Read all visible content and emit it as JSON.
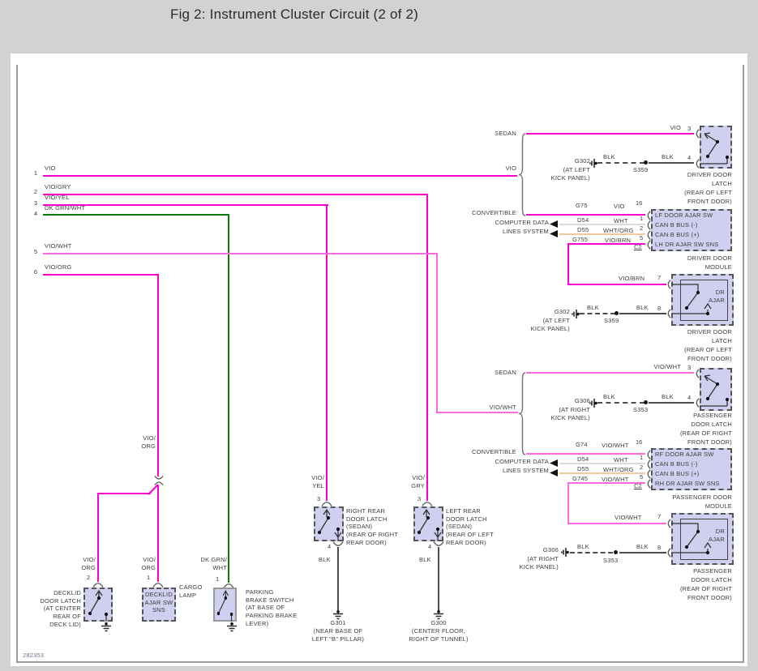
{
  "header": {
    "title": "Fig 2: Instrument Cluster Circuit (2 of 2)"
  },
  "footer": {
    "code": "282353"
  },
  "bus": {
    "wires": [
      {
        "num": "1",
        "label": "VIO"
      },
      {
        "num": "2",
        "label": "VIO/GRY"
      },
      {
        "num": "3",
        "label": "VIO/YEL"
      },
      {
        "num": "4",
        "label": "DK GRN/WHT"
      },
      {
        "num": "5",
        "label": "VIO/WHT"
      },
      {
        "num": "6",
        "label": "VIO/ORG"
      }
    ],
    "mid_label": "VIO/\nORG"
  },
  "bottom": {
    "decklid_latch": {
      "wire": "VIO/\nORG",
      "pin": "2",
      "label": "DECKLID\nDOOR LATCH\n(AT CENTER\nREAR OF\nDECK LID)"
    },
    "decklid_sns": {
      "wire": "VIO/\nORG",
      "pin": "1",
      "box_text": "DECKLID\nAJAR SW\nSNS",
      "cargo": "CARGO\nLAMP"
    },
    "parking": {
      "wire": "DK GRN/\nWHT",
      "pin": "1",
      "label": "PARKING\nBRAKE SWITCH\n(AT BASE OF\nPARKING BRAKE\nLEVER)"
    },
    "right_rear": {
      "wire": "VIO/\nYEL",
      "pin_top": "3",
      "pin_bot": "4",
      "blk": "BLK",
      "label": "RIGHT REAR\nDOOR LATCH\n(SEDAN)\n(REAR OF RIGHT\nREAR DOOR)",
      "ground": "G301",
      "ground_loc": "(NEAR BASE OF\nLEFT \"B\" PILLAR)"
    },
    "left_rear": {
      "wire": "VIO/\nGRY",
      "pin_top": "3",
      "pin_bot": "4",
      "blk": "BLK",
      "label": "LEFT REAR\nDOOR LATCH\n(SEDAN)\n(REAR OF LEFT\nREAR DOOR)",
      "ground": "G300",
      "ground_loc": "(CENTER FLOOR,\nRIGHT OF TUNNEL)"
    }
  },
  "driver": {
    "sedan": "SEDAN",
    "convertible": "CONVERTIBLE",
    "bus_label": "VIO",
    "computer_data": "COMPUTER DATA\nLINES SYSTEM",
    "top_latch": {
      "wire": "VIO",
      "pin_in": "3",
      "pin_gnd": "4",
      "blk_a": "BLK",
      "blk_b": "BLK",
      "ground": "G302",
      "ground_loc": "(AT LEFT\nKICK PANEL)",
      "splice": "S359",
      "label": "DRIVER DOOR\nLATCH\n(REAR OF LEFT\nFRONT DOOR)"
    },
    "module": {
      "rows": [
        {
          "circuit": "G75",
          "wire": "VIO",
          "pin": "16",
          "name": "LF DOOR AJAR SW"
        },
        {
          "circuit": "D54",
          "wire": "WHT",
          "pin": "1",
          "name": "CAN B BUS (-)"
        },
        {
          "circuit": "D55",
          "wire": "WHT/ORG",
          "pin": "2",
          "name": "CAN B BUS (+)"
        },
        {
          "circuit": "G755",
          "wire": "VIO/BRN",
          "pin": "5",
          "name": "LH DR AJAR SW SNS"
        }
      ],
      "connector": "C2",
      "label": "DRIVER DOOR\nMODULE"
    },
    "ajar_latch": {
      "wire": "VIO/BRN",
      "pin_in": "7",
      "pin_gnd": "8",
      "blk_a": "BLK",
      "blk_b": "BLK",
      "ground": "G302",
      "ground_loc": "(AT LEFT\nKICK PANEL)",
      "splice": "S359",
      "switch_label": "DR\nAJAR",
      "label": "DRIVER DOOR\nLATCH\n(REAR OF LEFT\nFRONT DOOR)"
    }
  },
  "passenger": {
    "sedan": "SEDAN",
    "convertible": "CONVERTIBLE",
    "bus_label": "VIO/WHT",
    "computer_data": "COMPUTER DATA\nLINES SYSTEM",
    "top_latch": {
      "wire": "VIO/WHT",
      "pin_in": "3",
      "pin_gnd": "4",
      "blk_a": "BLK",
      "blk_b": "BLK",
      "ground": "G306",
      "ground_loc": "(AT RIGHT\nKICK PANEL)",
      "splice": "S353",
      "label": "PASSENGER\nDOOR LATCH\n(REAR OF RIGHT\nFRONT DOOR)"
    },
    "module": {
      "rows": [
        {
          "circuit": "G74",
          "wire": "VIO/WHT",
          "pin": "16",
          "name": "RF DOOR AJAR SW"
        },
        {
          "circuit": "D54",
          "wire": "WHT",
          "pin": "1",
          "name": "CAN B BUS (-)"
        },
        {
          "circuit": "D55",
          "wire": "WHT/ORG",
          "pin": "2",
          "name": "CAN B BUS (+)"
        },
        {
          "circuit": "G745",
          "wire": "VIO/WHT",
          "pin": "5",
          "name": "RH DR AJAR SW SNS"
        }
      ],
      "connector": "C2",
      "label": "PASSENGER DOOR\nMODULE"
    },
    "ajar_latch": {
      "wire": "VIO/WHT",
      "pin_in": "7",
      "pin_gnd": "8",
      "blk_a": "BLK",
      "blk_b": "BLK",
      "ground": "G306",
      "ground_loc": "(AT RIGHT\nKICK PANEL)",
      "splice": "S353",
      "switch_label": "DR\nAJAR",
      "label": "PASSENGER\nDOOR LATCH\n(REAR OF RIGHT\nFRONT DOOR)"
    }
  },
  "colors": {
    "vio": "#ff00cc",
    "vio_wht": "#ff6ade",
    "dk_grn_wht": "#0b7a0b",
    "wht": "#dcdcdc",
    "wht_org": "#f2c89c",
    "blk": "#4d4d4d",
    "box_fill": "#cfcfef",
    "frame": "#9c9c9c"
  }
}
